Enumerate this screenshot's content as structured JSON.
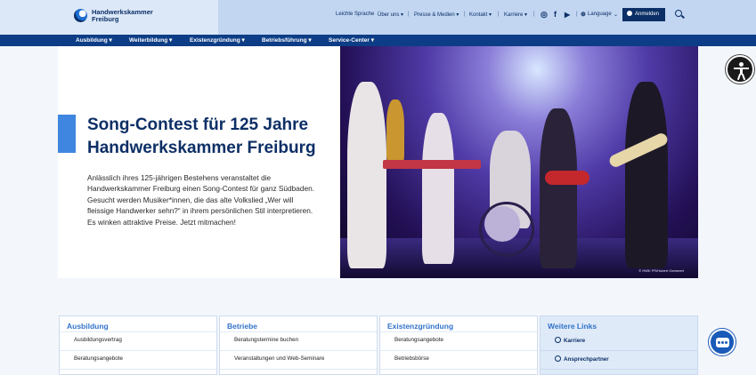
{
  "brand": {
    "line1": "Handwerkskammer",
    "line2": "Freiburg"
  },
  "top_nav": {
    "leichte_sprache": "Leichte Sprache",
    "ueber_uns": "Über uns ▾",
    "presse": "Presse & Medien ▾",
    "kontakt": "Kontakt ▾",
    "karriere": "Karriere ▾",
    "language": "Language",
    "login": "Anmelden",
    "separator": "|"
  },
  "social": {
    "instagram": "◎",
    "facebook": "f",
    "youtube": "▶",
    "globe": "⊕"
  },
  "main_nav": [
    "Ausbildung ▾",
    "Weiterbildung ▾",
    "Existenzgründung ▾",
    "Betriebsführung ▾",
    "Service-Center ▾"
  ],
  "hero": {
    "title": "Song-Contest für 125 Jahre Handwerkskammer Freiburg",
    "body": "Anlässlich ihres 125-jährigen Bestehens veranstaltet die Handwerkskammer Freiburg einen Song-Contest für ganz Südbaden. Gesucht werden Musiker*innen, die das alte Volkslied „Wer will fleissige Handwerker sehn?“ in ihrem persönlichen Stil interpretieren. Es winken attraktive Preise. Jetzt mitmachen!",
    "image_credit": "© HWK FR/Hubert Gemmert"
  },
  "columns": [
    {
      "title": "Ausbildung",
      "rows": [
        "Ausbildungsvertrag",
        "Beratungsangebote"
      ]
    },
    {
      "title": "Betriebe",
      "rows": [
        "Beratungstermine buchen",
        "Veranstaltungen und Web-Seminare"
      ]
    },
    {
      "title": "Existenzgründung",
      "rows": [
        "Beratungsangebote",
        "Betriebsbörse"
      ]
    },
    {
      "title": "Weitere Links",
      "rows": [
        "Karriere",
        "Ansprechpartner"
      ]
    }
  ],
  "colors": {
    "navy": "#0d3d86",
    "accent": "#3f86e0",
    "header_bg": "#c2d6f2"
  }
}
